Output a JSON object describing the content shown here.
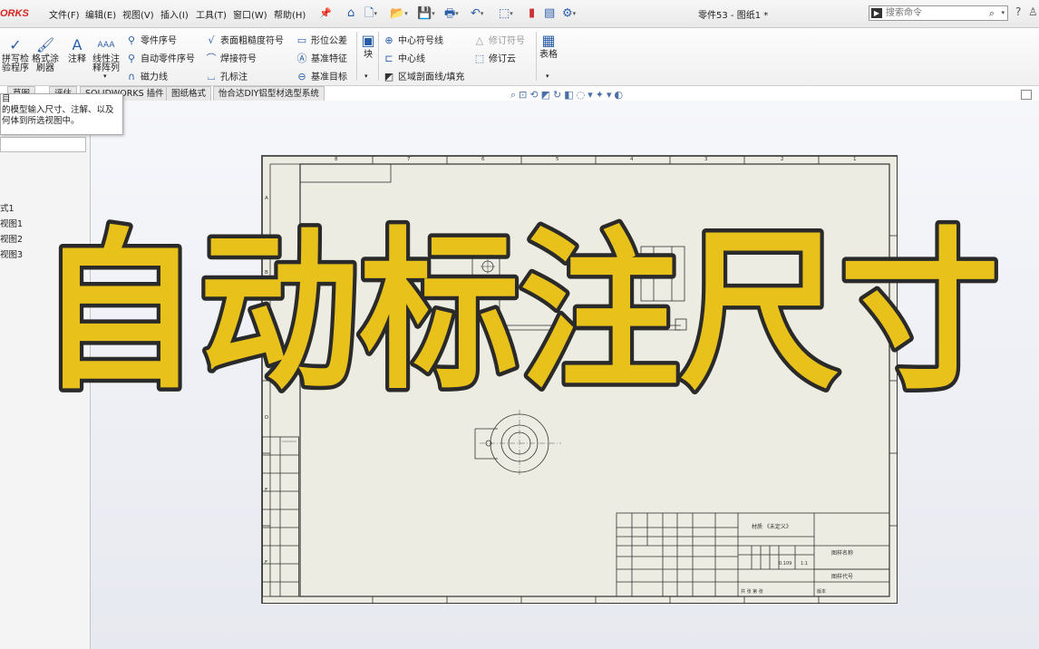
{
  "app": {
    "logo_text": "ORKS",
    "doc_title": "零件53 - 图纸1 *"
  },
  "menu": [
    "文件(F)",
    "编辑(E)",
    "视图(V)",
    "插入(I)",
    "工具(T)",
    "窗口(W)",
    "帮助(H)"
  ],
  "search": {
    "placeholder": "搜索命令"
  },
  "ribbon": {
    "spell_check": "拼写检\n验程序",
    "format_painter": "格式涂\n刷器",
    "note": "注释",
    "linear_pattern": "线性注\n释阵列",
    "balloon": "零件序号",
    "auto_balloon": "自动零件序号",
    "magnetic_line": "磁力线",
    "surface_finish": "表面粗糙度符号",
    "weld_symbol": "焊接符号",
    "hole_callout": "孔标注",
    "gtol": "形位公差",
    "datum_feature": "基准特征",
    "datum_target": "基准目标",
    "block": "块",
    "center_mark": "中心符号线",
    "centerline": "中心线",
    "hatch": "区域剖面线/填充",
    "revision_symbol": "修订符号",
    "revision_cloud": "修订云",
    "table": "表格"
  },
  "tabs": [
    "草图",
    "评估",
    "SOLIDWORKS 插件",
    "图纸格式",
    "怡合达DIY铝型材选型系统"
  ],
  "tooltip": {
    "line1": "目",
    "line2": "的模型输入尺寸、注解、以及",
    "line3": "何体到所选视图中。"
  },
  "tree": [
    "式1",
    "视图1",
    "视图2",
    "视图3"
  ],
  "sheet": {
    "col_numbers": [
      "1",
      "2",
      "3",
      "4",
      "5",
      "6",
      "7",
      "8"
    ],
    "row_letters": [
      "A",
      "B",
      "C",
      "D",
      "E",
      "F"
    ],
    "tb_material": "材质 《未定义》",
    "tb_name": "图样名称",
    "tb_code": "图样代号",
    "tb_scale": "1:1",
    "tb_weight": "0.109",
    "tb_sheets": "共  张  第  张",
    "tb_version": "版本"
  },
  "overlay": {
    "text": "自动标注尺寸"
  }
}
